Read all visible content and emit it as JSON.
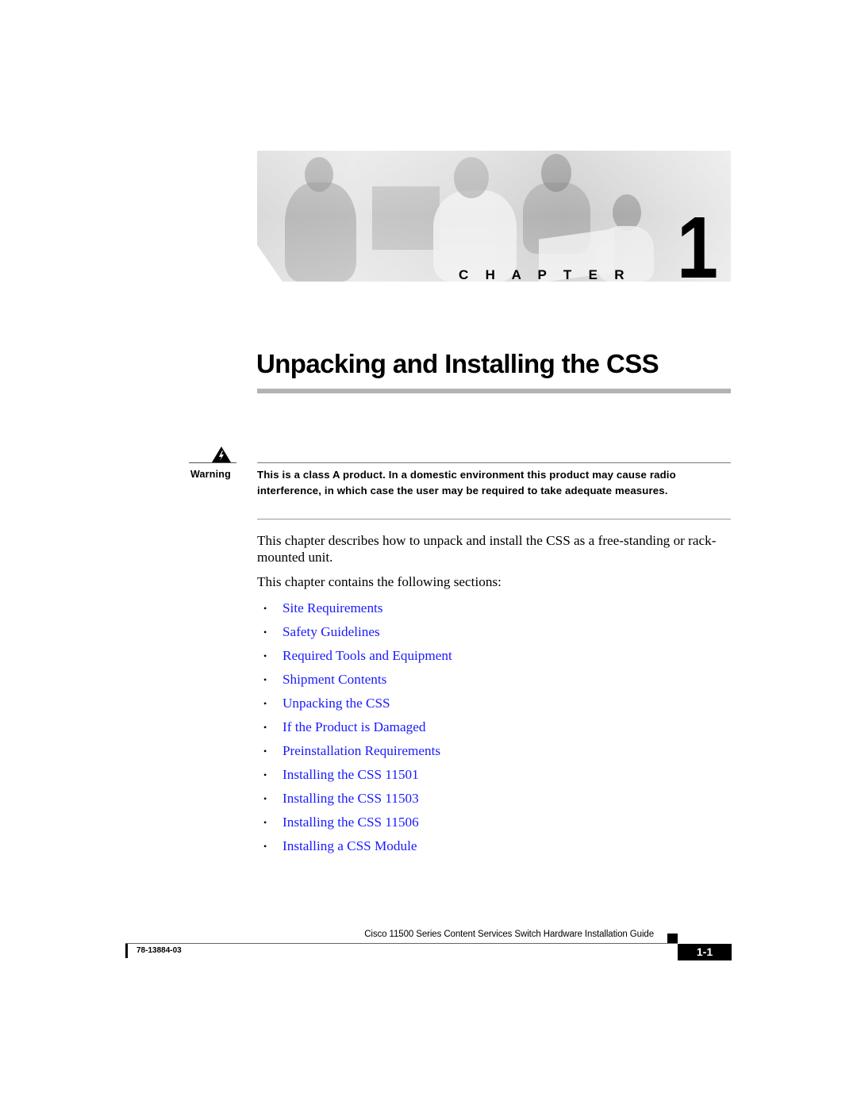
{
  "banner": {
    "image_description": "grayscale photo of four business people around a laptop",
    "chapter_label": "C H A P T E R",
    "chapter_number": "1"
  },
  "title": "Unpacking and Installing the CSS",
  "warning": {
    "icon": "warning-triangle-icon",
    "label": "Warning",
    "text": "This is a class A product. In a domestic environment this product may cause radio interference, in which case the user may be required to take adequate measures."
  },
  "body": {
    "intro": "This chapter describes how to unpack and install the CSS as a free-standing or rack-mounted unit.",
    "sections_intro": "This chapter contains the following sections:",
    "bullet_glyph": "•",
    "sections": [
      "Site Requirements",
      "Safety Guidelines",
      "Required Tools and Equipment",
      "Shipment Contents",
      "Unpacking the CSS",
      "If the Product is Damaged",
      "Preinstallation Requirements",
      "Installing the CSS 11501",
      "Installing the CSS 11503",
      "Installing the CSS 11506",
      "Installing a CSS Module"
    ],
    "link_color": "#1a1aff"
  },
  "footer": {
    "guide_title": "Cisco 11500 Series Content Services Switch Hardware Installation Guide",
    "doc_number": "78-13884-03",
    "page_number": "1-1"
  }
}
